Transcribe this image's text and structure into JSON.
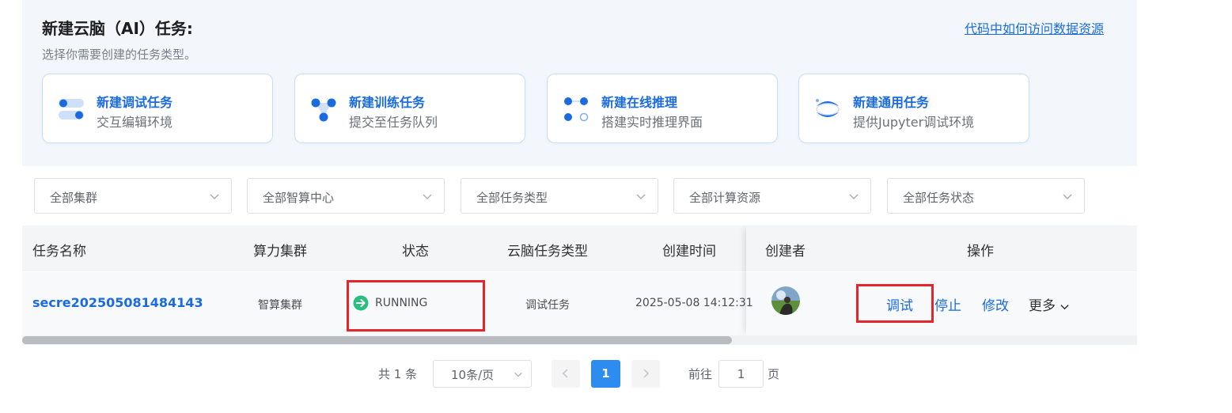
{
  "header": {
    "title": "新建云脑（AI）任务:",
    "subtitle": "选择你需要创建的任务类型。",
    "help_link": "代码中如何访问数据资源"
  },
  "task_types": [
    {
      "title": "新建调试任务",
      "desc": "交互编辑环境",
      "icon": "toggle-icon"
    },
    {
      "title": "新建训练任务",
      "desc": "提交至任务队列",
      "icon": "nodes-icon"
    },
    {
      "title": "新建在线推理",
      "desc": "搭建实时推理界面",
      "icon": "dots-grid-icon"
    },
    {
      "title": "新建通用任务",
      "desc": "提供Jupyter调试环境",
      "icon": "jupyter-icon"
    }
  ],
  "filters": [
    {
      "label": "全部集群"
    },
    {
      "label": "全部智算中心"
    },
    {
      "label": "全部任务类型"
    },
    {
      "label": "全部计算资源"
    },
    {
      "label": "全部任务状态"
    }
  ],
  "table": {
    "columns": [
      "任务名称",
      "算力集群",
      "状态",
      "云脑任务类型",
      "创建时间",
      "创建者",
      "操作"
    ],
    "rows": [
      {
        "name": "secre202505081484143",
        "cluster": "智算集群",
        "status": "RUNNING",
        "task_type": "调试任务",
        "created": "2025-05-08 14:12:31",
        "actions": {
          "debug": "调试",
          "stop": "停止",
          "edit": "修改",
          "more": "更多"
        }
      }
    ]
  },
  "pagination": {
    "total": "共 1 条",
    "page_size": "10条/页",
    "current": "1",
    "goto_label": "前往",
    "goto_value": "1",
    "page_suffix": "页"
  },
  "colors": {
    "accent": "#1a6be0",
    "running": "#2bbf7f",
    "highlight": "#e3262c",
    "active_page": "#2d8cf0"
  }
}
